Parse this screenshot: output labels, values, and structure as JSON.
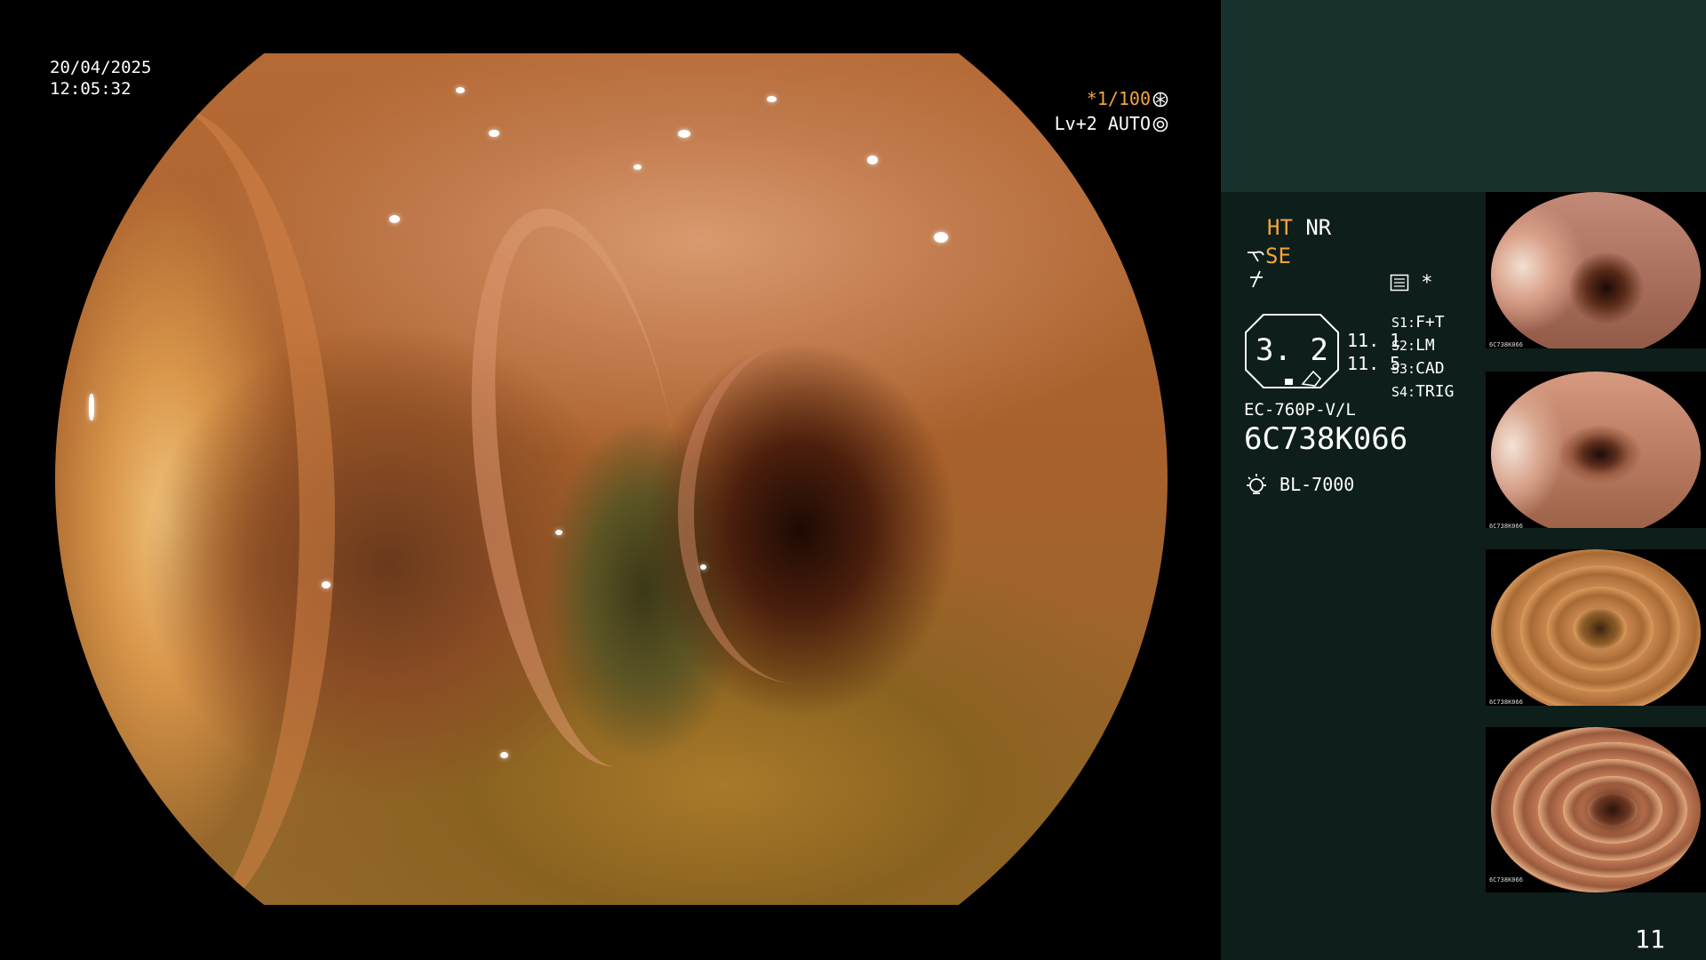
{
  "overlay": {
    "date": "20/04/2025",
    "time": "12:05:32",
    "magnification": "*1/100",
    "level": "Lv+2 AUTO"
  },
  "panel": {
    "ht_label": "HT",
    "nr_label": "NR",
    "se_label": "SE",
    "star": "*",
    "octagon_value": "3. 2",
    "col_values": [
      "11. 1",
      "11. 5"
    ],
    "switches": [
      {
        "key": "S1:",
        "value": "F+T"
      },
      {
        "key": "S2:",
        "value": "LM"
      },
      {
        "key": "S3:",
        "value": "CAD"
      },
      {
        "key": "S4:",
        "value": "TRIG"
      }
    ],
    "scope_model": "EC-760P-V/L",
    "scope_serial": "6C738K066",
    "light_source": "BL-7000"
  },
  "thumbnails": [
    {
      "serial": "6C738K066"
    },
    {
      "serial": "6C738K066"
    },
    {
      "serial": "6C738K066"
    },
    {
      "serial": "6C738K066"
    }
  ],
  "page_number": "11",
  "colors": {
    "accent": "#f3a53a",
    "panel_bg": "#0e1e1b",
    "panel_top_bg": "#17312d"
  },
  "icons": [
    "shutter-icon",
    "auto-iris-icon",
    "tool-icon",
    "structure-icon",
    "menu-icon",
    "lamp-icon"
  ]
}
